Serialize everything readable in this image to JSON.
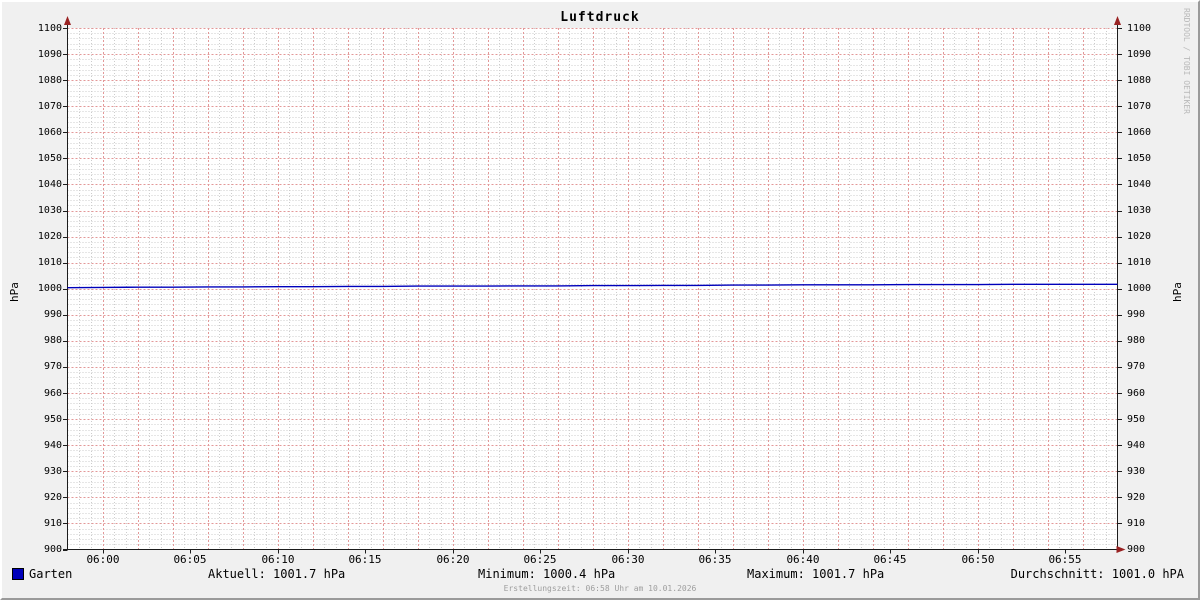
{
  "header": {
    "title": "Luftdruck"
  },
  "watermark": "RRDTOOL / TOBI OETIKER",
  "axes": {
    "left_label": "hPa",
    "right_label": "hPa"
  },
  "legend": {
    "label": "Garten",
    "swatch_color": "#0000bb",
    "stats": {
      "aktuell": "Aktuell: 1001.7 hPa",
      "minimum": "Minimum: 1000.4 hPa",
      "maximum": "Maximum: 1001.7 hPa",
      "durchschnitt": "Durchschnitt: 1001.0 hPA"
    }
  },
  "footer": {
    "creation_time": "Erstellungszeit: 06:58 Uhr am 10.01.2026"
  },
  "colors": {
    "outer_bg": "#f0f0f0",
    "canvas_bg": "#ffffff",
    "major_grid": "#e39898",
    "minor_grid": "#cccccc",
    "axis": "#1c1c1c",
    "arrow": "#992222",
    "line": "#0000bb"
  },
  "chart_data": {
    "type": "line",
    "title": "Luftdruck",
    "ylabel": "hPa",
    "ylim": [
      900,
      1100
    ],
    "y_tick_step": 10,
    "y_minor_step": 2,
    "x_start_minute": 358,
    "x_end_minute": 418,
    "x_window": "05:58 - 06:58",
    "x_major_grid_minutes": 2,
    "x_minor_grid_minutes": 0.6667,
    "grid": "dotted",
    "legend_position": "bottom",
    "x_ticks": [
      {
        "label": "06:00",
        "minute": 360
      },
      {
        "label": "06:05",
        "minute": 365
      },
      {
        "label": "06:10",
        "minute": 370
      },
      {
        "label": "06:15",
        "minute": 375
      },
      {
        "label": "06:20",
        "minute": 380
      },
      {
        "label": "06:25",
        "minute": 385
      },
      {
        "label": "06:30",
        "minute": 390
      },
      {
        "label": "06:35",
        "minute": 395
      },
      {
        "label": "06:40",
        "minute": 400
      },
      {
        "label": "06:45",
        "minute": 405
      },
      {
        "label": "06:50",
        "minute": 410
      },
      {
        "label": "06:55",
        "minute": 415
      }
    ],
    "series": [
      {
        "name": "Garten",
        "color": "#0000bb",
        "x_minutes": [
          358,
          360,
          362,
          364,
          366,
          368,
          370,
          372,
          374,
          376,
          378,
          380,
          382,
          384,
          386,
          388,
          390,
          392,
          394,
          396,
          398,
          400,
          402,
          404,
          406,
          408,
          410,
          412,
          414,
          416,
          418
        ],
        "values": [
          1000.4,
          1000.5,
          1000.6,
          1000.6,
          1000.7,
          1000.7,
          1000.8,
          1000.8,
          1000.9,
          1000.9,
          1001.0,
          1001.0,
          1001.0,
          1001.1,
          1001.1,
          1001.2,
          1001.2,
          1001.3,
          1001.3,
          1001.4,
          1001.4,
          1001.5,
          1001.5,
          1001.5,
          1001.6,
          1001.6,
          1001.6,
          1001.7,
          1001.7,
          1001.7,
          1001.7
        ]
      }
    ],
    "stats": {
      "aktuell": 1001.7,
      "minimum": 1000.4,
      "maximum": 1001.7,
      "durchschnitt": 1001.0
    }
  }
}
